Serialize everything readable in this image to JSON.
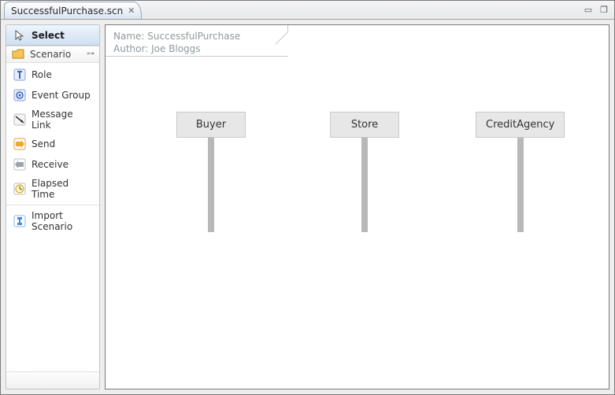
{
  "tab": {
    "title": "SuccessfulPurchase.scn",
    "close_glyph": "✕"
  },
  "window_controls": {
    "minimize": "▭",
    "maximize": "❐"
  },
  "palette": {
    "select_label": "Select",
    "drawer_label": "Scenario",
    "items": [
      {
        "label": "Role"
      },
      {
        "label": "Event Group"
      },
      {
        "label": "Message Link"
      },
      {
        "label": "Send"
      },
      {
        "label": "Receive"
      },
      {
        "label": "Elapsed Time"
      },
      {
        "label": "Import Scenario"
      }
    ]
  },
  "scenario": {
    "name_label": "Name:",
    "name_value": "SuccessfulPurchase",
    "author_label": "Author:",
    "author_value": "Joe Bloggs",
    "roles": [
      "Buyer",
      "Store",
      "CreditAgency"
    ]
  }
}
